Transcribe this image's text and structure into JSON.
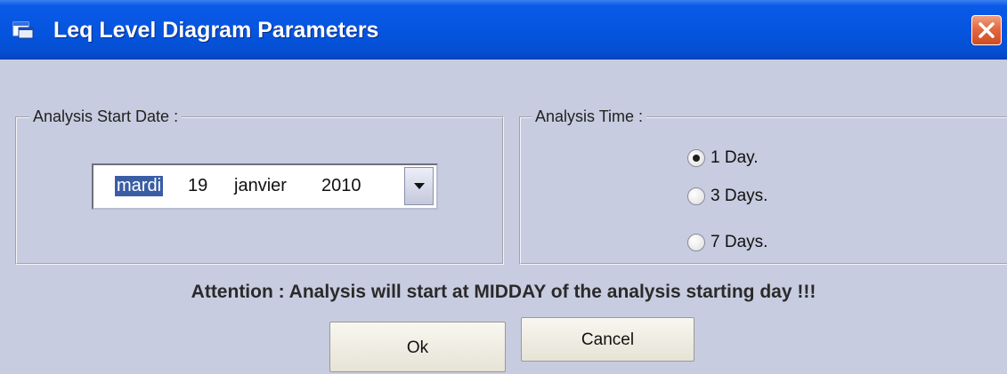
{
  "window": {
    "title": "Leq Level Diagram Parameters",
    "icon": "app-window-icon",
    "close_icon": "close-icon"
  },
  "start_date": {
    "legend": "Analysis Start Date :",
    "weekday": "mardi",
    "day": "19",
    "month": "janvier",
    "year": "2010",
    "dropdown_icon": "chevron-down-icon"
  },
  "analysis_time": {
    "legend": "Analysis Time :",
    "options": [
      {
        "label": "1 Day.",
        "selected": true
      },
      {
        "label": "3 Days.",
        "selected": false
      },
      {
        "label": "7 Days.",
        "selected": false
      }
    ]
  },
  "attention_text": "Attention : Analysis will start at MIDDAY of the analysis starting day !!!",
  "buttons": {
    "ok": "Ok",
    "cancel": "Cancel"
  },
  "colors": {
    "titlebar": "#0555e0",
    "dialog_bg": "#c8cce0",
    "close_button": "#e36840",
    "selection": "#3a5ea4"
  }
}
